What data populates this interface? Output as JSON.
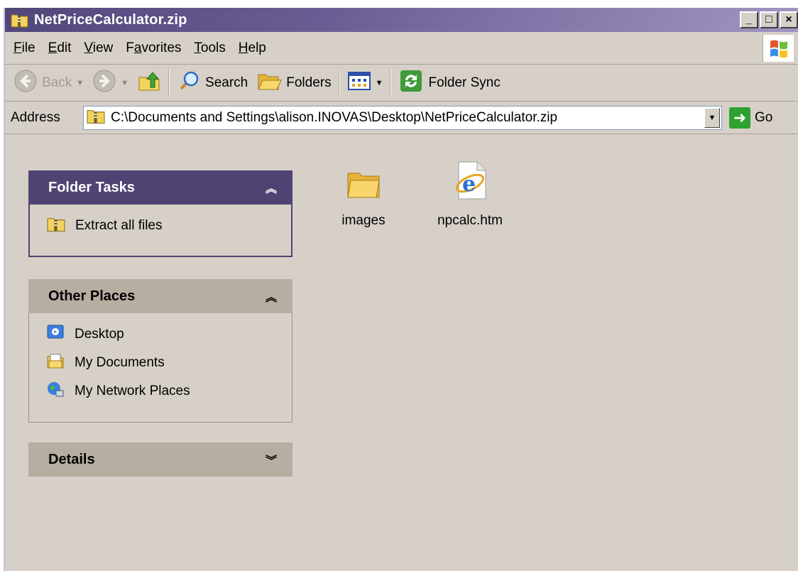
{
  "window": {
    "title": "NetPriceCalculator.zip",
    "buttons": {
      "minimize": "_",
      "maximize": "□",
      "close": "×"
    }
  },
  "menu": {
    "items": [
      {
        "label": "File",
        "accel": "F",
        "rest": "ile"
      },
      {
        "label": "Edit",
        "accel": "E",
        "rest": "dit"
      },
      {
        "label": "View",
        "accel": "V",
        "rest": "iew"
      },
      {
        "label": "Favorites",
        "pre": "F",
        "accel": "a",
        "rest": "vorites"
      },
      {
        "label": "Tools",
        "accel": "T",
        "rest": "ools"
      },
      {
        "label": "Help",
        "accel": "H",
        "rest": "elp"
      }
    ]
  },
  "toolbar": {
    "back_label": "Back",
    "search_label": "Search",
    "folders_label": "Folders",
    "sync_label": "Folder Sync"
  },
  "address": {
    "label": "Address",
    "value": "C:\\Documents and Settings\\alison.INOVAS\\Desktop\\NetPriceCalculator.zip",
    "go_label": "Go"
  },
  "panes": {
    "folder_tasks": {
      "title": "Folder Tasks",
      "items": [
        {
          "label": "Extract all files",
          "icon": "zip-folder-icon"
        }
      ]
    },
    "other_places": {
      "title": "Other Places",
      "items": [
        {
          "label": "Desktop",
          "icon": "desktop-icon"
        },
        {
          "label": "My Documents",
          "icon": "my-documents-icon"
        },
        {
          "label": "My Network Places",
          "icon": "network-places-icon"
        }
      ]
    },
    "details": {
      "title": "Details"
    }
  },
  "files": [
    {
      "name": "images",
      "icon": "folder-icon"
    },
    {
      "name": "npcalc.htm",
      "icon": "html-document-icon"
    }
  ],
  "colors": {
    "titlebar_start": "#52477a",
    "titlebar_end": "#a294c1",
    "window_bg": "#d6d0c8",
    "folder_tasks_header": "#4f4373"
  }
}
